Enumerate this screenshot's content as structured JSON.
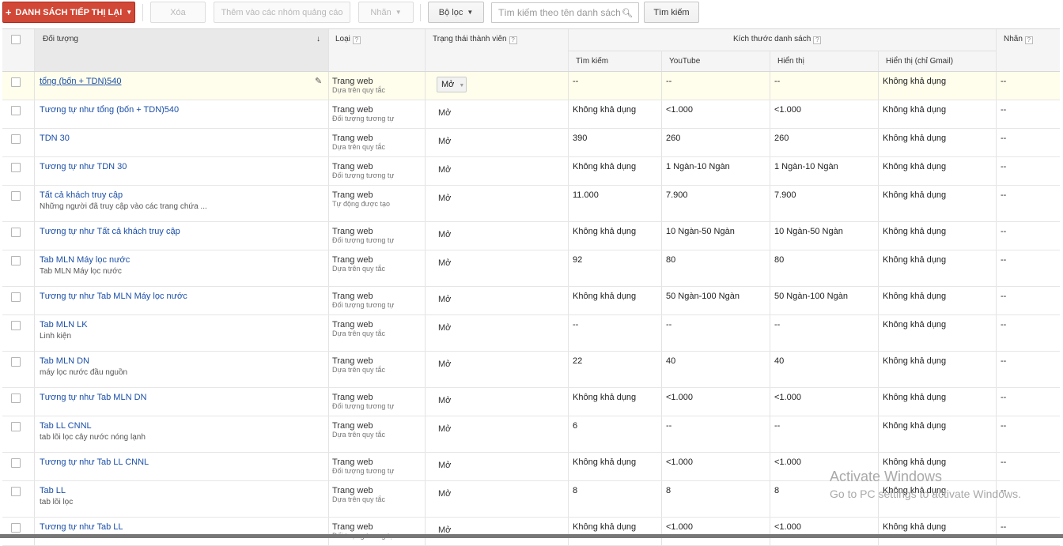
{
  "toolbar": {
    "add_list_label": "DANH SÁCH TIẾP THỊ LẠI",
    "delete_label": "Xóa",
    "add_to_groups_label": "Thêm vào các nhóm quảng cáo",
    "labels_label": "Nhãn",
    "filter_label": "Bộ lọc",
    "search_placeholder": "Tìm kiếm theo tên danh sách",
    "search_button_label": "Tìm kiếm",
    "primary_color": "#d14836"
  },
  "table": {
    "headers": {
      "audience": "Đối tượng",
      "type": "Loại",
      "membership_status": "Trạng thái thành viên",
      "list_size": "Kích thước danh sách",
      "search": "Tìm kiếm",
      "youtube": "YouTube",
      "display": "Hiển thị",
      "display_gmail": "Hiển thị (chỉ Gmail)",
      "labels": "Nhãn"
    },
    "rows": [
      {
        "name": "tổng (bốn + TDN)540",
        "desc": "",
        "type": "Trang web",
        "subtype": "Dựa trên quy tắc",
        "status": "Mở",
        "search": "--",
        "youtube": "--",
        "display": "--",
        "gmail": "Không khả dụng",
        "labels": "--"
      },
      {
        "name": "Tương tự như tổng (bốn + TDN)540",
        "desc": "",
        "type": "Trang web",
        "subtype": "Đối tượng tương tự",
        "status": "Mở",
        "search": "Không khả dụng",
        "youtube": "<1.000",
        "display": "<1.000",
        "gmail": "Không khả dụng",
        "labels": "--"
      },
      {
        "name": "TDN 30",
        "desc": "",
        "type": "Trang web",
        "subtype": "Dựa trên quy tắc",
        "status": "Mở",
        "search": "390",
        "youtube": "260",
        "display": "260",
        "gmail": "Không khả dụng",
        "labels": "--"
      },
      {
        "name": "Tương tự như TDN 30",
        "desc": "",
        "type": "Trang web",
        "subtype": "Đối tượng tương tự",
        "status": "Mở",
        "search": "Không khả dụng",
        "youtube": "1 Ngàn-10 Ngàn",
        "display": "1 Ngàn-10 Ngàn",
        "gmail": "Không khả dụng",
        "labels": "--"
      },
      {
        "name": "Tất cả khách truy cập",
        "desc": "Những người đã truy cập vào các trang chứa ...",
        "type": "Trang web",
        "subtype": "Tự động được tạo",
        "status": "Mở",
        "search": "11.000",
        "youtube": "7.900",
        "display": "7.900",
        "gmail": "Không khả dụng",
        "labels": "--"
      },
      {
        "name": "Tương tự như Tất cả khách truy cập",
        "desc": "",
        "type": "Trang web",
        "subtype": "Đối tượng tương tự",
        "status": "Mở",
        "search": "Không khả dụng",
        "youtube": "10 Ngàn-50 Ngàn",
        "display": "10 Ngàn-50 Ngàn",
        "gmail": "Không khả dụng",
        "labels": "--"
      },
      {
        "name": "Tab MLN Máy lọc nước",
        "desc": "Tab MLN Máy lọc nước",
        "type": "Trang web",
        "subtype": "Dựa trên quy tắc",
        "status": "Mở",
        "search": "92",
        "youtube": "80",
        "display": "80",
        "gmail": "Không khả dụng",
        "labels": "--"
      },
      {
        "name": "Tương tự như Tab MLN Máy lọc nước",
        "desc": "",
        "type": "Trang web",
        "subtype": "Đối tượng tương tự",
        "status": "Mở",
        "search": "Không khả dụng",
        "youtube": "50 Ngàn-100 Ngàn",
        "display": "50 Ngàn-100 Ngàn",
        "gmail": "Không khả dụng",
        "labels": "--"
      },
      {
        "name": "Tab MLN LK",
        "desc": "Linh kiện",
        "type": "Trang web",
        "subtype": "Dựa trên quy tắc",
        "status": "Mở",
        "search": "--",
        "youtube": "--",
        "display": "--",
        "gmail": "Không khả dụng",
        "labels": "--"
      },
      {
        "name": "Tab MLN DN",
        "desc": "máy lọc nước đầu nguồn",
        "type": "Trang web",
        "subtype": "Dựa trên quy tắc",
        "status": "Mở",
        "search": "22",
        "youtube": "40",
        "display": "40",
        "gmail": "Không khả dụng",
        "labels": "--"
      },
      {
        "name": "Tương tự như Tab MLN DN",
        "desc": "",
        "type": "Trang web",
        "subtype": "Đối tượng tương tự",
        "status": "Mở",
        "search": "Không khả dụng",
        "youtube": "<1.000",
        "display": "<1.000",
        "gmail": "Không khả dụng",
        "labels": "--"
      },
      {
        "name": "Tab LL CNNL",
        "desc": "tab lõi lọc cây nước nóng lạnh",
        "type": "Trang web",
        "subtype": "Dựa trên quy tắc",
        "status": "Mở",
        "search": "6",
        "youtube": "--",
        "display": "--",
        "gmail": "Không khả dụng",
        "labels": "--"
      },
      {
        "name": "Tương tự như Tab LL CNNL",
        "desc": "",
        "type": "Trang web",
        "subtype": "Đối tượng tương tự",
        "status": "Mở",
        "search": "Không khả dụng",
        "youtube": "<1.000",
        "display": "<1.000",
        "gmail": "Không khả dụng",
        "labels": "--"
      },
      {
        "name": "Tab LL",
        "desc": "tab lõi lọc",
        "type": "Trang web",
        "subtype": "Dựa trên quy tắc",
        "status": "Mở",
        "search": "8",
        "youtube": "8",
        "display": "8",
        "gmail": "Không khả dụng",
        "labels": "--"
      },
      {
        "name": "Tương tự như Tab LL",
        "desc": "",
        "type": "Trang web",
        "subtype": "Đối tượng tương tự",
        "status": "Mở",
        "search": "Không khả dụng",
        "youtube": "<1.000",
        "display": "<1.000",
        "gmail": "Không khả dụng",
        "labels": "--"
      }
    ]
  },
  "watermark": {
    "line1": "Activate Windows",
    "line2": "Go to PC settings to activate Windows."
  }
}
